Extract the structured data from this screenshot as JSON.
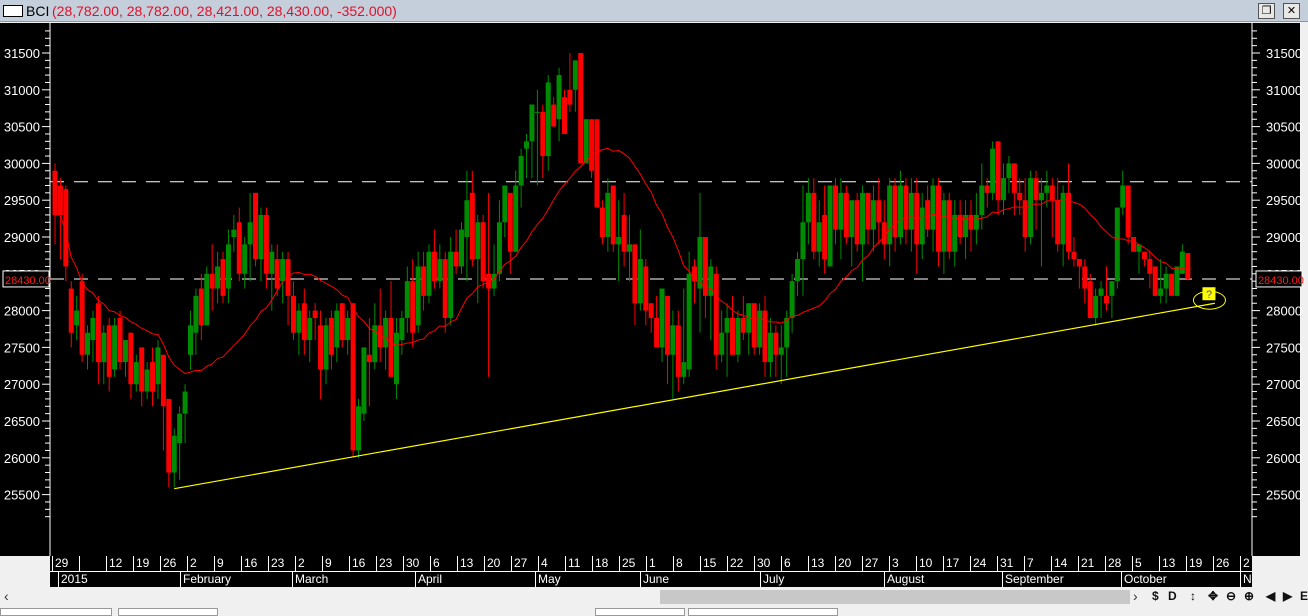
{
  "window": {
    "symbol": "BCI",
    "ohlc_text": "(28,782.00, 28,782.00, 28,421.00, 28,430.00, -352.000)",
    "restore_icon": "restore-icon",
    "close_icon": "close-icon"
  },
  "colors": {
    "up": "#008c00",
    "down": "#ff0000",
    "ma": "#ff0000",
    "trend": "#ffff00",
    "level": "#ffffff",
    "bg": "#000000"
  },
  "chart_data": {
    "type": "candlestick",
    "title": "BCI",
    "ylim": [
      25200,
      31800
    ],
    "yticks": [
      25500,
      26000,
      26500,
      27000,
      27500,
      28000,
      28500,
      29000,
      29500,
      30000,
      30500,
      31000,
      31500
    ],
    "last_price_label": "28430.00",
    "horizontal_levels": [
      29750,
      28430
    ],
    "trendline": [
      {
        "index": 22,
        "value": 25580
      },
      {
        "index": 214,
        "value": 28100
      }
    ],
    "annotation": {
      "label": "?",
      "index": 213
    },
    "moving_average_period": 20,
    "date_ticks": [
      "29",
      "",
      "12",
      "19",
      "26",
      "2",
      "9",
      "16",
      "23",
      "2",
      "9",
      "16",
      "23",
      "30",
      "6",
      "13",
      "20",
      "27",
      "4",
      "11",
      "18",
      "25",
      "1",
      "8",
      "15",
      "22",
      "30",
      "6",
      "13",
      "20",
      "27",
      "3",
      "10",
      "17",
      "24",
      "31",
      "7",
      "14",
      "21",
      "28",
      "5",
      "13",
      "19",
      "26",
      "2"
    ],
    "months": [
      "2015",
      "February",
      "March",
      "April",
      "May",
      "June",
      "July",
      "August",
      "September",
      "October",
      "No"
    ],
    "candles": [
      [
        29900,
        30000,
        28900,
        29300
      ],
      [
        29700,
        29800,
        28700,
        29300
      ],
      [
        29650,
        29700,
        28400,
        28600
      ],
      [
        28300,
        28400,
        27500,
        27700
      ],
      [
        27800,
        28200,
        27600,
        28000
      ],
      [
        28400,
        28500,
        27300,
        27400
      ],
      [
        27400,
        27800,
        27200,
        27700
      ],
      [
        27600,
        28000,
        27300,
        27900
      ],
      [
        28100,
        28200,
        27000,
        27300
      ],
      [
        27300,
        27800,
        27000,
        27700
      ],
      [
        27800,
        27900,
        26900,
        27100
      ],
      [
        27200,
        27900,
        27100,
        27800
      ],
      [
        27900,
        28000,
        27200,
        27300
      ],
      [
        27300,
        27600,
        27100,
        27600
      ],
      [
        27700,
        27700,
        26800,
        27000
      ],
      [
        27000,
        27400,
        26900,
        27300
      ],
      [
        27500,
        27500,
        26700,
        26900
      ],
      [
        26900,
        27300,
        26800,
        27200
      ],
      [
        27300,
        27500,
        26700,
        26900
      ],
      [
        27000,
        27600,
        26800,
        27500
      ],
      [
        27400,
        27400,
        26100,
        26700
      ],
      [
        26800,
        26800,
        25600,
        25800
      ],
      [
        25800,
        26400,
        25600,
        26300
      ],
      [
        26200,
        26700,
        25700,
        26600
      ],
      [
        26600,
        27000,
        26200,
        26900
      ],
      [
        27400,
        28000,
        27200,
        27800
      ],
      [
        27700,
        28300,
        27400,
        28200
      ],
      [
        28300,
        28500,
        27600,
        27800
      ],
      [
        27800,
        28600,
        27800,
        28500
      ],
      [
        28500,
        28900,
        28000,
        28300
      ],
      [
        28300,
        28800,
        28100,
        28600
      ],
      [
        28700,
        28800,
        28100,
        28200
      ],
      [
        28300,
        29100,
        28100,
        28900
      ],
      [
        29000,
        29300,
        28800,
        29100
      ],
      [
        29200,
        29400,
        28400,
        28500
      ],
      [
        28500,
        29000,
        28300,
        28900
      ],
      [
        28900,
        29600,
        28400,
        29200
      ],
      [
        29600,
        29600,
        28600,
        28700
      ],
      [
        28700,
        29400,
        28400,
        29300
      ],
      [
        29300,
        29400,
        28300,
        28500
      ],
      [
        28500,
        28900,
        28000,
        28800
      ],
      [
        28700,
        28900,
        28200,
        28300
      ],
      [
        28400,
        28800,
        28100,
        28700
      ],
      [
        28700,
        28800,
        27800,
        28200
      ],
      [
        28200,
        28400,
        27600,
        27700
      ],
      [
        27700,
        28100,
        27400,
        28000
      ],
      [
        28100,
        28300,
        27400,
        27600
      ],
      [
        27600,
        28000,
        27300,
        27900
      ],
      [
        28000,
        28100,
        27600,
        27900
      ],
      [
        27800,
        28000,
        26800,
        27200
      ],
      [
        27200,
        27900,
        27000,
        27800
      ],
      [
        27900,
        28000,
        27200,
        27400
      ],
      [
        27500,
        28100,
        27300,
        28000
      ],
      [
        28100,
        28100,
        27500,
        27600
      ],
      [
        27600,
        28000,
        27400,
        27900
      ],
      [
        28100,
        28100,
        26000,
        26100
      ],
      [
        26100,
        26800,
        26000,
        26700
      ],
      [
        26600,
        27400,
        26500,
        27500
      ],
      [
        27400,
        27900,
        26700,
        27300
      ],
      [
        27300,
        28100,
        27200,
        27800
      ],
      [
        27800,
        28300,
        27300,
        27500
      ],
      [
        27500,
        28000,
        27200,
        27900
      ],
      [
        27900,
        28400,
        27100,
        27100
      ],
      [
        27000,
        27900,
        26800,
        27700
      ],
      [
        27600,
        28000,
        27400,
        27900
      ],
      [
        27900,
        28600,
        27700,
        28400
      ],
      [
        28400,
        28700,
        27500,
        27700
      ],
      [
        27800,
        28800,
        27700,
        28600
      ],
      [
        28600,
        28800,
        28000,
        28200
      ],
      [
        28200,
        28900,
        28100,
        28800
      ],
      [
        28800,
        29100,
        28300,
        28400
      ],
      [
        28400,
        28900,
        28300,
        28700
      ],
      [
        28700,
        28800,
        27700,
        27900
      ],
      [
        27900,
        29000,
        27800,
        28800
      ],
      [
        28800,
        29100,
        28500,
        28600
      ],
      [
        28600,
        29200,
        28500,
        29100
      ],
      [
        29000,
        29900,
        28400,
        29500
      ],
      [
        29600,
        29900,
        28600,
        28700
      ],
      [
        28700,
        29300,
        28100,
        29200
      ],
      [
        29200,
        29300,
        28300,
        28400
      ],
      [
        28500,
        29600,
        27100,
        28300
      ],
      [
        28300,
        28900,
        28200,
        28500
      ],
      [
        28500,
        29500,
        28400,
        29200
      ],
      [
        29200,
        29700,
        29000,
        29700
      ],
      [
        29600,
        29600,
        28500,
        28800
      ],
      [
        28800,
        29900,
        28800,
        29700
      ],
      [
        29700,
        30200,
        29400,
        30100
      ],
      [
        30200,
        30400,
        29800,
        30300
      ],
      [
        30300,
        30600,
        29800,
        30800
      ],
      [
        30700,
        31000,
        29700,
        30700
      ],
      [
        30700,
        30800,
        29800,
        30100
      ],
      [
        30100,
        31200,
        29900,
        31100
      ],
      [
        30800,
        30900,
        30500,
        30500
      ],
      [
        30600,
        31300,
        30300,
        31200
      ],
      [
        30900,
        31000,
        30500,
        30400
      ],
      [
        31000,
        31500,
        30700,
        30800
      ],
      [
        31000,
        31300,
        30700,
        31400
      ],
      [
        31500,
        31500,
        30000,
        30000
      ],
      [
        30000,
        30600,
        30000,
        30600
      ],
      [
        30600,
        30600,
        29800,
        29900
      ],
      [
        30600,
        30600,
        29400,
        29400
      ],
      [
        29400,
        29500,
        28900,
        29000
      ],
      [
        29000,
        29800,
        28800,
        29600
      ],
      [
        29700,
        29700,
        28800,
        28900
      ],
      [
        28900,
        29500,
        28400,
        29000
      ],
      [
        29300,
        29600,
        28600,
        28800
      ],
      [
        28800,
        29300,
        28400,
        28900
      ],
      [
        28900,
        28900,
        27800,
        28100
      ],
      [
        28100,
        29100,
        28000,
        28700
      ],
      [
        28600,
        28700,
        27800,
        28000
      ],
      [
        28100,
        28100,
        27700,
        27900
      ],
      [
        27900,
        28200,
        27500,
        27500
      ],
      [
        27500,
        28300,
        27300,
        28300
      ],
      [
        28200,
        28200,
        27000,
        27400
      ],
      [
        27400,
        28000,
        26800,
        27800
      ],
      [
        27800,
        28000,
        26900,
        27100
      ],
      [
        27100,
        28300,
        27000,
        27300
      ],
      [
        27200,
        28800,
        27100,
        28500
      ],
      [
        28600,
        28700,
        28100,
        28400
      ],
      [
        28300,
        29600,
        27700,
        29000
      ],
      [
        29000,
        29000,
        27900,
        28200
      ],
      [
        28200,
        28700,
        27600,
        28600
      ],
      [
        28500,
        28600,
        27200,
        27400
      ],
      [
        27400,
        28000,
        27300,
        27700
      ],
      [
        27700,
        28100,
        27100,
        27900
      ],
      [
        27900,
        28200,
        27400,
        27400
      ],
      [
        27400,
        28000,
        27300,
        27900
      ],
      [
        27900,
        28200,
        27600,
        27700
      ],
      [
        27700,
        28100,
        27400,
        28100
      ],
      [
        28100,
        28100,
        27400,
        27500
      ],
      [
        27500,
        28100,
        27400,
        28000
      ],
      [
        28000,
        28200,
        27100,
        27300
      ],
      [
        27300,
        27900,
        27100,
        27700
      ],
      [
        27700,
        27800,
        27100,
        27400
      ],
      [
        27400,
        27800,
        27000,
        27500
      ],
      [
        27500,
        28000,
        27100,
        27900
      ],
      [
        27900,
        28500,
        27700,
        28400
      ],
      [
        28400,
        28800,
        28200,
        28700
      ],
      [
        28700,
        29700,
        28200,
        29200
      ],
      [
        29200,
        29800,
        28900,
        29600
      ],
      [
        29600,
        29800,
        28700,
        28800
      ],
      [
        28800,
        29500,
        28600,
        29200
      ],
      [
        29300,
        29700,
        28500,
        28700
      ],
      [
        28600,
        29700,
        28600,
        29700
      ],
      [
        29700,
        29800,
        28900,
        29100
      ],
      [
        29100,
        29800,
        28700,
        29600
      ],
      [
        29600,
        29700,
        28900,
        29000
      ],
      [
        29000,
        29300,
        28600,
        29500
      ],
      [
        29500,
        29600,
        28800,
        28900
      ],
      [
        28900,
        29700,
        28400,
        29600
      ],
      [
        29600,
        29600,
        28900,
        29100
      ],
      [
        29100,
        29700,
        28800,
        29500
      ],
      [
        29500,
        29800,
        28900,
        29200
      ],
      [
        29200,
        29500,
        28700,
        28900
      ],
      [
        28900,
        29800,
        28600,
        29700
      ],
      [
        29700,
        29800,
        28800,
        29000
      ],
      [
        29000,
        29900,
        28900,
        29700
      ],
      [
        29700,
        29800,
        28900,
        29100
      ],
      [
        29100,
        29800,
        28800,
        29600
      ],
      [
        29600,
        29800,
        28500,
        28900
      ],
      [
        28900,
        29600,
        28700,
        29400
      ],
      [
        29500,
        29700,
        29000,
        29100
      ],
      [
        29100,
        29800,
        28800,
        29700
      ],
      [
        29700,
        29800,
        28600,
        28800
      ],
      [
        28800,
        29600,
        28500,
        29500
      ],
      [
        29500,
        29600,
        28700,
        28800
      ],
      [
        28800,
        29500,
        28600,
        29300
      ],
      [
        29300,
        29500,
        28900,
        29000
      ],
      [
        29000,
        29500,
        28700,
        29300
      ],
      [
        29300,
        29500,
        28800,
        29100
      ],
      [
        29100,
        29600,
        28900,
        29300
      ],
      [
        29300,
        30000,
        29100,
        29700
      ],
      [
        29700,
        29800,
        29400,
        29600
      ],
      [
        29600,
        30300,
        29500,
        30200
      ],
      [
        30300,
        30300,
        29300,
        29500
      ],
      [
        29500,
        30000,
        29300,
        29800
      ],
      [
        29800,
        30100,
        29600,
        30000
      ],
      [
        30000,
        30000,
        29300,
        29600
      ],
      [
        29600,
        29800,
        29300,
        29500
      ],
      [
        29500,
        29800,
        28800,
        29000
      ],
      [
        29000,
        29900,
        28900,
        29800
      ],
      [
        29800,
        29900,
        29100,
        29500
      ],
      [
        29500,
        29800,
        28600,
        29600
      ],
      [
        29600,
        29900,
        29400,
        29700
      ],
      [
        29700,
        29800,
        29000,
        29500
      ],
      [
        29500,
        29800,
        28800,
        28900
      ],
      [
        28900,
        29700,
        28600,
        29600
      ],
      [
        29600,
        30000,
        28700,
        28800
      ],
      [
        28800,
        29000,
        28600,
        28700
      ],
      [
        28700,
        28700,
        28300,
        28600
      ],
      [
        28600,
        28700,
        28100,
        28300
      ],
      [
        28400,
        28500,
        27900,
        27900
      ],
      [
        27900,
        28300,
        27800,
        28200
      ],
      [
        28200,
        28400,
        27900,
        28300
      ],
      [
        28200,
        28600,
        28000,
        28100
      ],
      [
        28200,
        28400,
        27900,
        28400
      ],
      [
        28400,
        29400,
        28300,
        29400
      ],
      [
        29400,
        29900,
        29300,
        29700
      ],
      [
        29700,
        29700,
        28900,
        29000
      ],
      [
        29000,
        29000,
        28800,
        28800
      ],
      [
        28800,
        28900,
        28500,
        28900
      ],
      [
        28800,
        28800,
        28600,
        28700
      ],
      [
        28700,
        28800,
        28300,
        28500
      ],
      [
        28600,
        28600,
        28200,
        28200
      ],
      [
        28200,
        28700,
        28100,
        28300
      ],
      [
        28300,
        28600,
        28100,
        28500
      ],
      [
        28500,
        28500,
        28300,
        28200
      ],
      [
        28200,
        28600,
        28200,
        28600
      ],
      [
        28500,
        28900,
        28500,
        28800
      ],
      [
        28782,
        28782,
        28421,
        28430
      ]
    ]
  },
  "toolbar": {
    "scroll_left": "‹",
    "scroll_right": "›",
    "tools": [
      "$",
      "D",
      "↕",
      "✥",
      "⊖",
      "⊕",
      "◀",
      "▶",
      "E"
    ],
    "tool_names": [
      "currency-icon",
      "display-icon",
      "vertical-scale-icon",
      "crosshair-icon",
      "zoom-out-icon",
      "zoom-in-icon",
      "scroll-back-icon",
      "scroll-forward-icon",
      "menu-icon"
    ]
  }
}
